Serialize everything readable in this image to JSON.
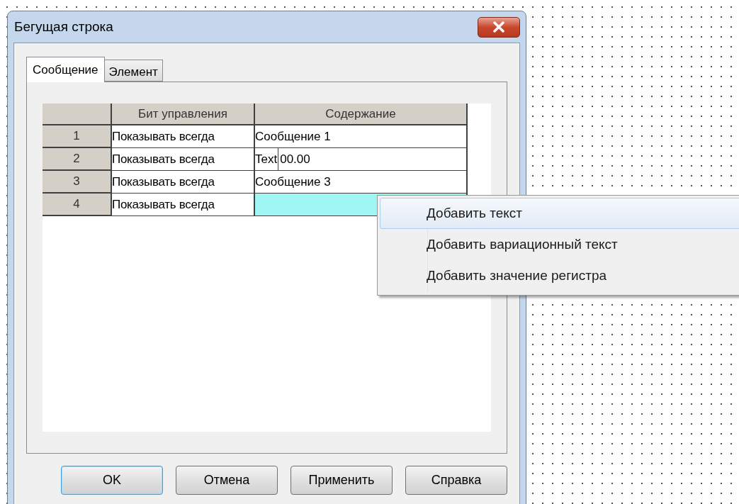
{
  "window": {
    "title": "Бегущая строка"
  },
  "tabs": [
    {
      "label": "Сообщение",
      "selected": true
    },
    {
      "label": "Элемент",
      "selected": false
    }
  ],
  "table": {
    "columns": [
      "Бит управления",
      "Содержание"
    ],
    "rows": [
      {
        "number": "1",
        "control": "Показывать всегда",
        "content": [
          "Сообщение 1"
        ],
        "selected": false
      },
      {
        "number": "2",
        "control": "Показывать всегда",
        "content": [
          "Text",
          "00.00"
        ],
        "selected": false
      },
      {
        "number": "3",
        "control": "Показывать всегда",
        "content": [
          "Сообщение 3"
        ],
        "selected": false
      },
      {
        "number": "4",
        "control": "Показывать всегда",
        "selected": true
      }
    ]
  },
  "context_menu": {
    "items": [
      {
        "label": "Добавить текст",
        "selected": true
      },
      {
        "label": "Добавить вариационный текст",
        "selected": false
      },
      {
        "label": "Добавить значение регистра",
        "selected": false
      }
    ]
  },
  "buttons": [
    {
      "label": "OK",
      "default": true
    },
    {
      "label": "Отмена",
      "default": false
    },
    {
      "label": "Применить",
      "default": false
    },
    {
      "label": "Справка",
      "default": false
    }
  ]
}
